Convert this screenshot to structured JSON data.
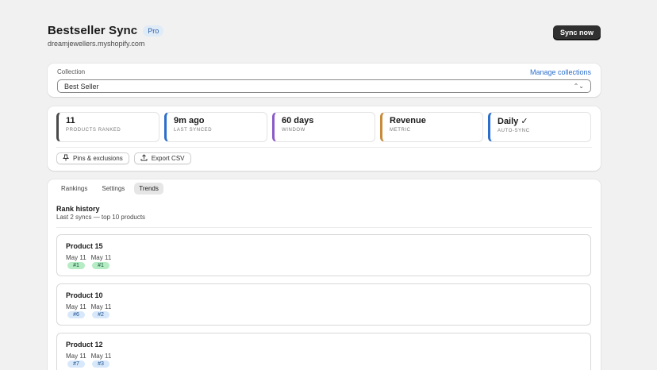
{
  "app": {
    "title": "Bestseller Sync",
    "badge": "Pro",
    "shop_domain": "dreamjewellers.myshopify.com",
    "sync_button": "Sync now"
  },
  "collection": {
    "label": "Collection",
    "manage_link": "Manage collections",
    "selected": "Best Seller"
  },
  "stats": [
    {
      "value": "11",
      "caption": "PRODUCTS RANKED",
      "accent": "#4a4a4a"
    },
    {
      "value": "9m ago",
      "caption": "LAST SYNCED",
      "accent": "#2c6ecb"
    },
    {
      "value": "60 days",
      "caption": "WINDOW",
      "accent": "#8a5cc7"
    },
    {
      "value": "Revenue",
      "caption": "METRIC",
      "accent": "#c88b3a"
    },
    {
      "value": "Daily ✓",
      "caption": "AUTO-SYNC",
      "accent": "#2c6ecb"
    }
  ],
  "actions": {
    "pins": "Pins & exclusions",
    "export": "Export CSV"
  },
  "tabs": [
    "Rankings",
    "Settings",
    "Trends"
  ],
  "active_tab": "Trends",
  "rank_history": {
    "title": "Rank history",
    "subtitle": "Last 2 syncs — top 10 products",
    "products": [
      {
        "name": "Product 15",
        "dates": [
          "May 11",
          "May 11"
        ],
        "ranks": [
          "#1",
          "#1"
        ],
        "tone": "green"
      },
      {
        "name": "Product 10",
        "dates": [
          "May 11",
          "May 11"
        ],
        "ranks": [
          "#6",
          "#2"
        ],
        "tone": "blue"
      },
      {
        "name": "Product 12",
        "dates": [
          "May 11",
          "May 11"
        ],
        "ranks": [
          "#7",
          "#3"
        ],
        "tone": "blue"
      }
    ]
  }
}
